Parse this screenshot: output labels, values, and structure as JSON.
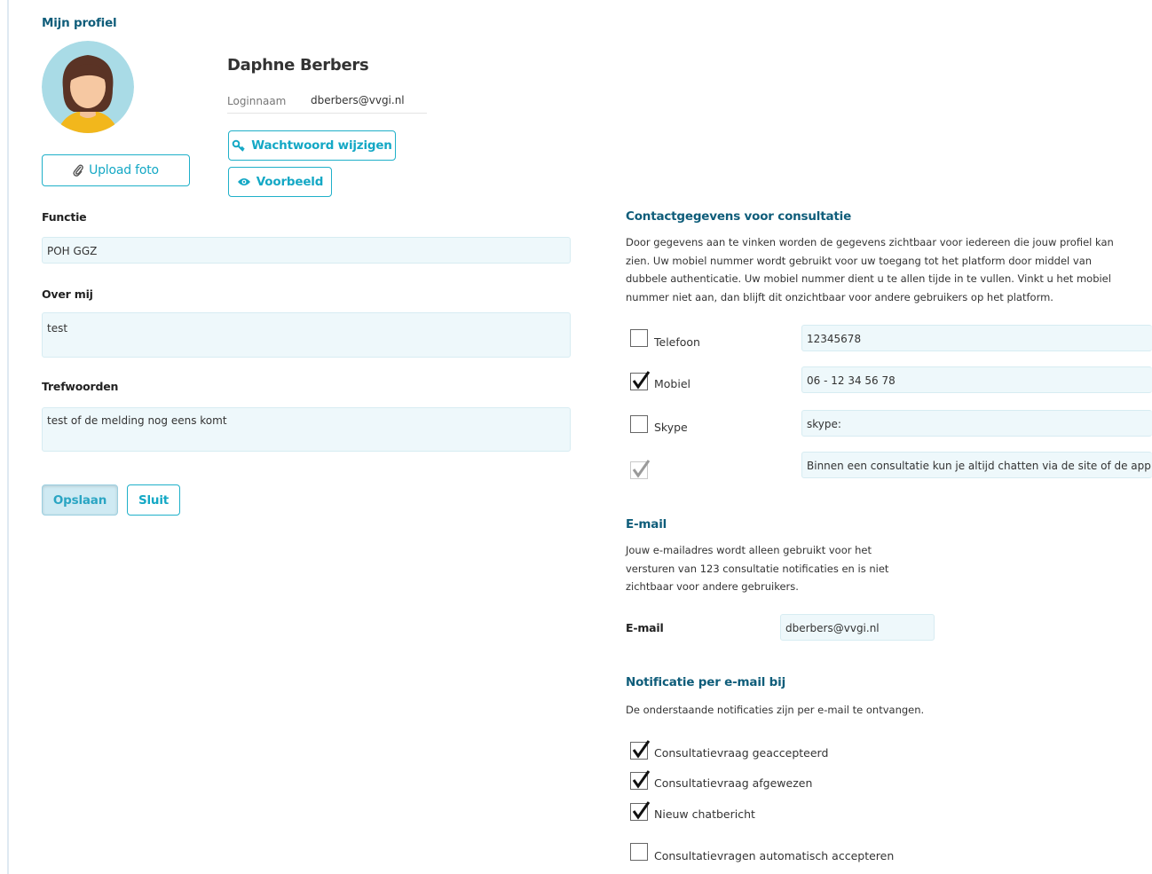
{
  "profile": {
    "heading": "Mijn profiel",
    "name": "Daphne Berbers",
    "login_label": "Loginnaam",
    "login_value": "dberbers@vvgi.nl",
    "change_password_label": "Wachtwoord wijzigen",
    "preview_label": "Voorbeeld",
    "upload_photo_label": "Upload foto"
  },
  "form": {
    "function_label": "Functie",
    "function_value": "POH GGZ",
    "about_label": "Over mij",
    "about_value": "test",
    "keywords_label": "Trefwoorden",
    "keywords_value": "test of de melding nog eens komt",
    "save_label": "Opslaan",
    "close_label": "Sluit"
  },
  "contact": {
    "heading": "Contactgegevens voor consultatie",
    "description_lines": [
      "Door gegevens aan te vinken worden de gegevens zichtbaar voor iedereen die jouw profiel kan",
      "zien. Uw mobiel nummer wordt gebruikt voor uw toegang tot het platform door middel van",
      "dubbele authenticatie. Uw mobiel nummer dient u te allen tijde in te vullen. Vinkt u het mobiel",
      "nummer niet aan, dan blijft dit onzichtbaar voor andere gebruikers op het platform."
    ],
    "rows": [
      {
        "label": "Telefoon",
        "value": "12345678",
        "checked": false,
        "disabled": false
      },
      {
        "label": "Mobiel",
        "value": "06 - 12 34 56 78",
        "checked": true,
        "disabled": false
      },
      {
        "label": "Skype",
        "value": "skype:",
        "checked": false,
        "disabled": false
      },
      {
        "label": "",
        "value": "Binnen een consultatie kun je altijd chatten via de site of de app",
        "checked": true,
        "disabled": true
      }
    ]
  },
  "email": {
    "heading": "E-mail",
    "description_lines": [
      "Jouw e-mailadres wordt alleen gebruikt voor het",
      "versturen van 123 consultatie notificaties en is niet",
      "zichtbaar voor andere gebruikers."
    ],
    "label": "E-mail",
    "value": "dberbers@vvgi.nl"
  },
  "notifications": {
    "heading": "Notificatie per e-mail bij",
    "description": "De onderstaande notificaties zijn per e-mail te ontvangen.",
    "items": [
      {
        "label": "Consultatievraag geaccepteerd",
        "checked": true
      },
      {
        "label": "Consultatievraag afgewezen",
        "checked": true
      },
      {
        "label": "Nieuw chatbericht",
        "checked": true
      },
      {
        "label": "Consultatievragen automatisch accepteren",
        "checked": false
      }
    ]
  },
  "colors": {
    "accent": "#1fb0c9",
    "heading": "#0f5d7a",
    "field_bg": "#eef8fb"
  },
  "icons": {
    "upload": "paperclip-icon",
    "password": "key-icon",
    "preview": "eye-icon",
    "check": "checkmark-icon"
  }
}
